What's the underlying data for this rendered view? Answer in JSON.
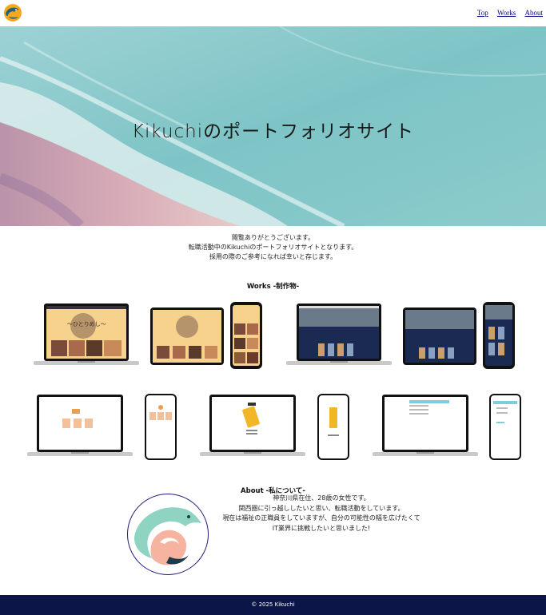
{
  "header": {
    "nav": [
      "Top",
      "Works",
      "About"
    ]
  },
  "hero": {
    "title": "Kikuchiのポートフォリオサイト"
  },
  "intro": {
    "lines": [
      "閲覧ありがとうございます。",
      "転職活動中のKikuchiのポートフォリオサイトとなります。",
      "採用の際のご参考になれば幸いと存じます。"
    ]
  },
  "works": {
    "title": "Works -制作物-"
  },
  "about": {
    "title": "About -私について-",
    "lines": [
      "神奈川県在住、28歳の女性です。",
      "関西圏に引っ越ししたいと思い、転職活動をしています。",
      "現在は福祉の正職員をしていますが、自分の可能性の幅を広げたくて",
      "IT業界に挑戦したいと思いました!"
    ]
  },
  "footer": {
    "copyright": "© 2025 Kikuchi"
  },
  "colors": {
    "footer_bg": "#0b1547",
    "nav_link": "#00008b",
    "logo_bg": "#f5a81c",
    "logo_dolphin": "#24617a"
  }
}
